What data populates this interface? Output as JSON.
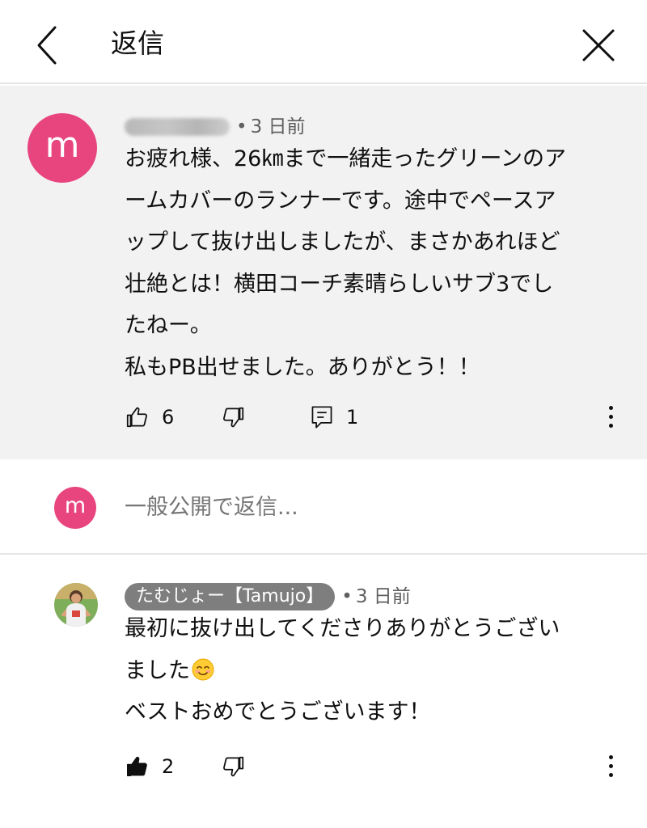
{
  "header": {
    "title": "返信",
    "back_icon": "chevron-left-icon",
    "close_icon": "close-icon"
  },
  "parent_comment": {
    "avatar_letter": "m",
    "avatar_color": "#e8457f",
    "timestamp": "3 日前",
    "separator": "•",
    "text_lines": [
      "お疲れ様、26㎞まで一緒走ったグリーンのア",
      "ームカバーのランナーです。途中でペースア",
      "ップして抜け出しましたが、まさかあれほど",
      "壮絶とは！横田コーチ素晴らしいサブ3でし",
      "たねー。",
      "私もPB出せました。ありがとう！！"
    ],
    "like_count": "6",
    "reply_count": "1"
  },
  "reply_box": {
    "avatar_letter": "m",
    "placeholder": "一般公開で返信..."
  },
  "reply": {
    "author": "たむじょー【Tamujo】",
    "separator": "•",
    "timestamp": "3 日前",
    "text_line_1": "最初に抜け出してくださりありがとうござい",
    "text_line_2": "ました",
    "text_line_3": "ベストおめでとうございます！",
    "emoji_icon": "smiling-face-emoji",
    "like_count": "2",
    "liked": true
  },
  "colors": {
    "accent_pink": "#e8457f",
    "highlight_bg": "#f2f2f2",
    "secondary_text": "#606060",
    "author_pill_bg": "#7e7e7e"
  }
}
